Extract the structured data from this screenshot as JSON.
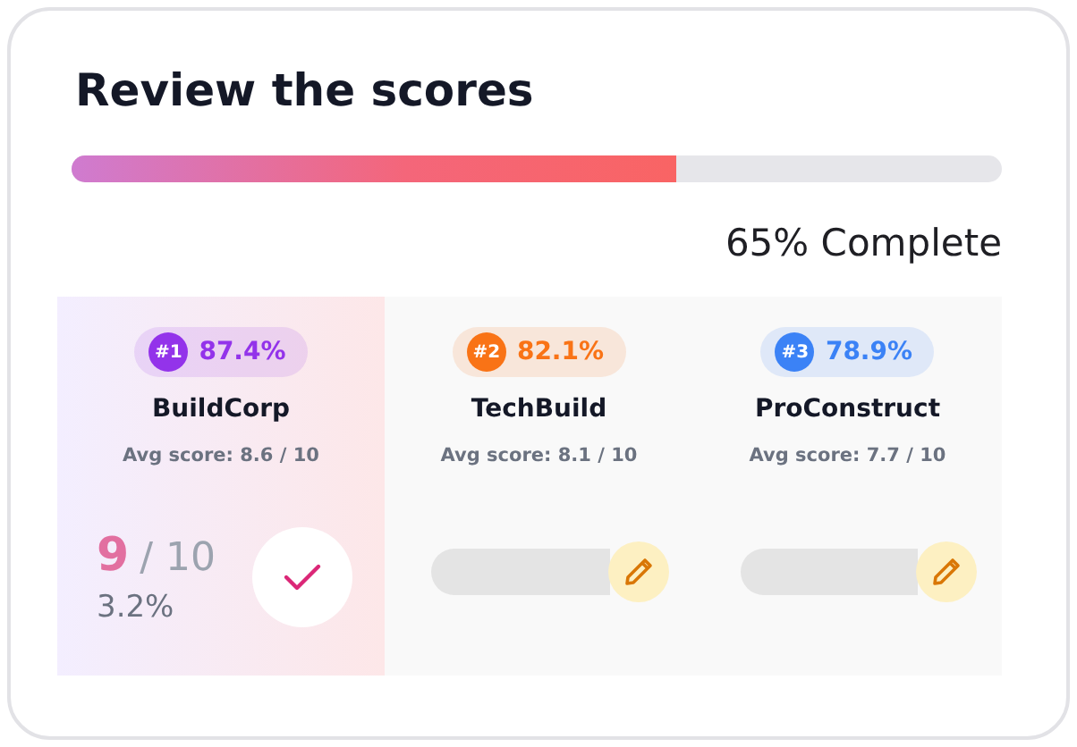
{
  "title": "Review the scores",
  "progress": {
    "level": 0.65,
    "label": "65% Complete"
  },
  "candidates": [
    {
      "rank": "#1",
      "percent": "87.4%",
      "name": "BuildCorp",
      "avg": "Avg score: 8.6 / 10",
      "color": "#9333ea",
      "selected": true,
      "kind": "scored",
      "score": "9",
      "out_of": "/ 10",
      "share": "3.2%"
    },
    {
      "rank": "#2",
      "percent": "82.1%",
      "name": "TechBuild",
      "avg": "Avg score: 8.1 / 10",
      "color": "#f97316",
      "selected": false,
      "kind": "pending"
    },
    {
      "rank": "#3",
      "percent": "78.9%",
      "name": "ProConstruct",
      "avg": "Avg score: 7.7 / 10",
      "color": "#3b82f6",
      "selected": false,
      "kind": "pending"
    }
  ]
}
